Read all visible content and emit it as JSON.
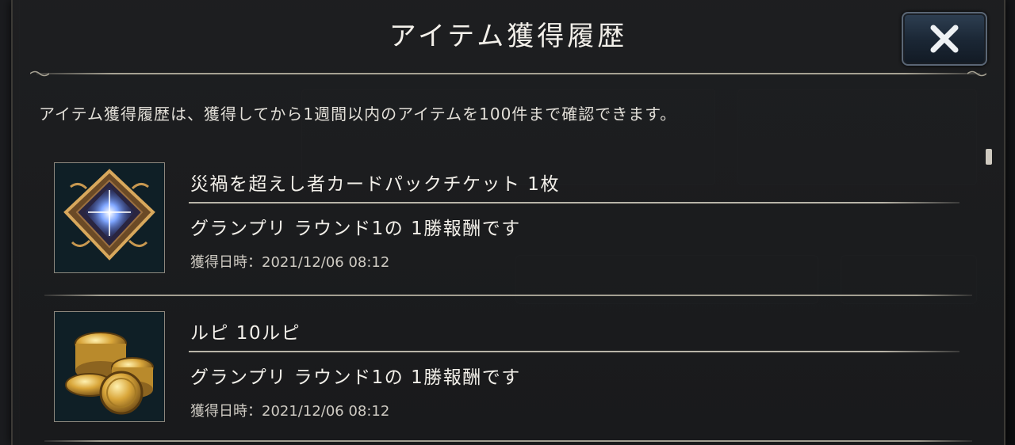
{
  "dialog": {
    "title": "アイテム獲得履歴",
    "close_icon": "close-x-icon",
    "description": "アイテム獲得履歴は、獲得してから1週間以内のアイテムを100件まで確認できます。"
  },
  "items": [
    {
      "icon": "card-pack-ticket-crystal-icon",
      "name": "災禍を超えし者カードパックチケット 1枚",
      "source": "グランプリ ラウンド1の 1勝報酬です",
      "date_label": "獲得日時：",
      "date_value": "2021/12/06 08:12"
    },
    {
      "icon": "gold-coins-icon",
      "name": "ルピ 10ルピ",
      "source": "グランプリ ラウンド1の 1勝報酬です",
      "date_label": "獲得日時：",
      "date_value": "2021/12/06 08:12"
    }
  ],
  "colors": {
    "panel": "#1e1f21",
    "text": "#f2efe9",
    "accent_gold": "#c9a24a",
    "close_button": "#1a2634"
  }
}
